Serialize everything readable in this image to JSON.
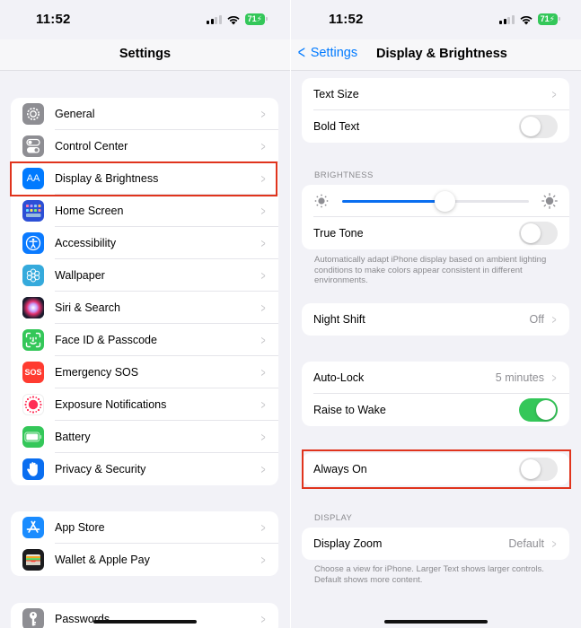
{
  "status_bar": {
    "time": "11:52",
    "battery": "71"
  },
  "left": {
    "nav_title": "Settings",
    "groups": [
      [
        {
          "label": "General",
          "icon": "gear-icon",
          "color": "#8e8e93"
        },
        {
          "label": "Control Center",
          "icon": "switches-icon",
          "color": "#8e8e93"
        },
        {
          "label": "Display & Brightness",
          "icon": "text-size-icon",
          "color": "#007aff",
          "glyph": "AA",
          "highlighted": true
        },
        {
          "label": "Home Screen",
          "icon": "app-grid-icon",
          "color": "#2c4fd6"
        },
        {
          "label": "Accessibility",
          "icon": "accessibility-icon",
          "color": "#0a7aff"
        },
        {
          "label": "Wallpaper",
          "icon": "flower-icon",
          "color": "#35aadc"
        },
        {
          "label": "Siri & Search",
          "icon": "siri-icon",
          "color": "#1c1c2e"
        },
        {
          "label": "Face ID & Passcode",
          "icon": "face-id-icon",
          "color": "#34c759"
        },
        {
          "label": "Emergency SOS",
          "icon": "sos-icon",
          "color": "#ff3b30",
          "glyph": "SOS"
        },
        {
          "label": "Exposure Notifications",
          "icon": "exposure-icon",
          "color": "#ffffff"
        },
        {
          "label": "Battery",
          "icon": "battery-icon",
          "color": "#34c759"
        },
        {
          "label": "Privacy & Security",
          "icon": "hand-icon",
          "color": "#0a6ef0"
        }
      ],
      [
        {
          "label": "App Store",
          "icon": "app-store-icon",
          "color": "#1a8cff"
        },
        {
          "label": "Wallet & Apple Pay",
          "icon": "wallet-icon",
          "color": "#1c1c1e"
        }
      ],
      [
        {
          "label": "Passwords",
          "icon": "key-icon",
          "color": "#8e8e93"
        }
      ]
    ]
  },
  "right": {
    "back_label": "Settings",
    "nav_title": "Display & Brightness",
    "text_size_label": "Text Size",
    "bold_text_label": "Bold Text",
    "bold_text_on": false,
    "brightness_header": "BRIGHTNESS",
    "brightness_level": 0.55,
    "true_tone_label": "True Tone",
    "true_tone_on": false,
    "true_tone_footer": "Automatically adapt iPhone display based on ambient lighting conditions to make colors appear consistent in different environments.",
    "night_shift_label": "Night Shift",
    "night_shift_value": "Off",
    "auto_lock_label": "Auto-Lock",
    "auto_lock_value": "5 minutes",
    "raise_to_wake_label": "Raise to Wake",
    "raise_to_wake_on": true,
    "always_on_label": "Always On",
    "always_on_on": false,
    "display_header": "DISPLAY",
    "display_zoom_label": "Display Zoom",
    "display_zoom_value": "Default",
    "display_zoom_footer": "Choose a view for iPhone. Larger Text shows larger controls. Default shows more content."
  },
  "colors": {
    "highlight": "#e0341d",
    "accent": "#007aff",
    "toggle_on": "#34c759"
  }
}
